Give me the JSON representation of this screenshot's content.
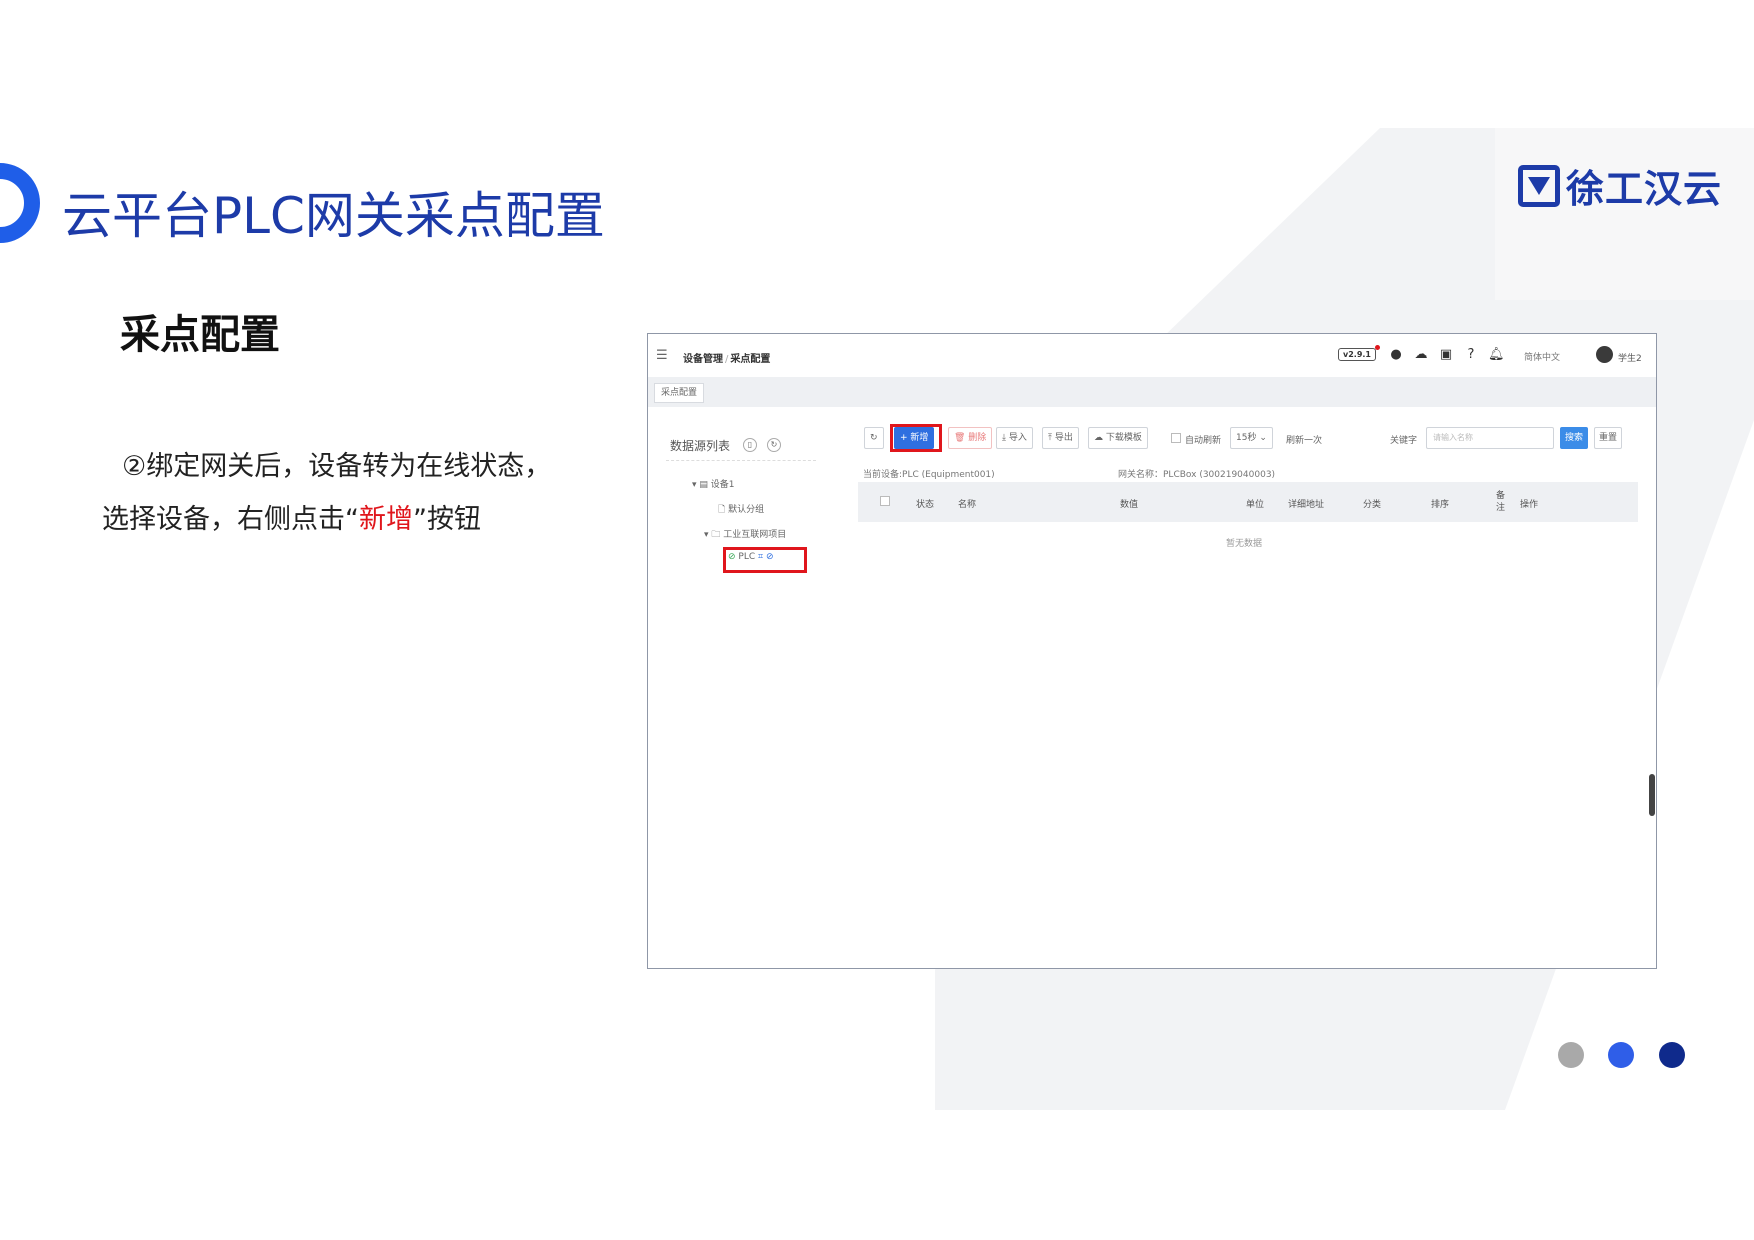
{
  "slide": {
    "title": "云平台PLC网关采点配置",
    "section_heading": "采点配置",
    "body_line1": "②绑定网关后，设备转为在线状态，选择设备，右侧点击“",
    "body_highlight": "新增",
    "body_line_end": "”按钮",
    "logo_text": "徐工汉云"
  },
  "colors": {
    "title": "#1d3ba8",
    "accent_blue": "#1f5ee8",
    "highlight_red": "#e0161c",
    "dot_gray": "#a9a9a9",
    "dot_blue": "#2f5ee8",
    "dot_navy": "#0f2a8c"
  },
  "screenshot": {
    "breadcrumb_parent": "设备管理",
    "breadcrumb_sep": "/",
    "breadcrumb_current": "采点配置",
    "version": "v2.9.1",
    "language": "简体中文",
    "user": "学生2",
    "tab": "采点配置",
    "left_panel_title": "数据源列表",
    "tree": {
      "device": "设备1",
      "default_group": "默认分组",
      "project": "工业互联网项目",
      "plc": "PLC"
    },
    "toolbar": {
      "add": "新增",
      "delete": "删除",
      "import": "导入",
      "export": "导出",
      "download_template": "下载模板",
      "auto_refresh": "自动刷新",
      "interval": "15秒",
      "refresh_once": "刷新一次",
      "keyword_label": "关键字",
      "keyword_placeholder": "请输入名称",
      "search": "搜索",
      "reset": "重置"
    },
    "info": {
      "current_device": "当前设备:PLC (Equipment001)",
      "gateway_name": "网关名称：PLCBox (300219040003)"
    },
    "columns": [
      "状态",
      "名称",
      "数值",
      "单位",
      "详细地址",
      "分类",
      "排序",
      "备注",
      "操作"
    ],
    "empty_text": "暂无数据"
  }
}
